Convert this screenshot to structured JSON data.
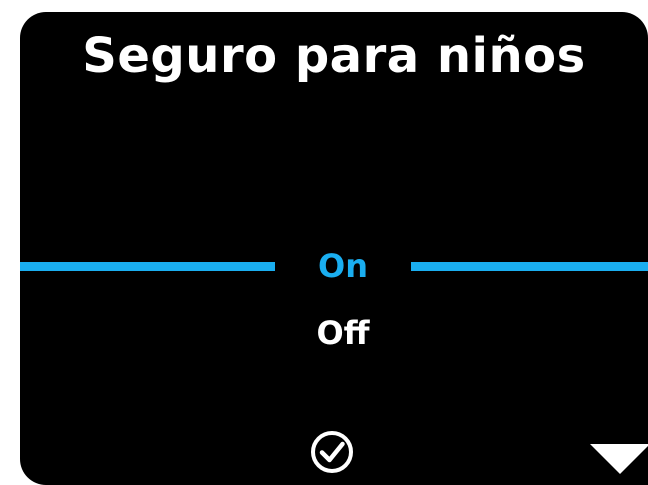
{
  "screen": {
    "title": "Seguro para niños"
  },
  "options": {
    "items": [
      {
        "label": "On",
        "selected": true
      },
      {
        "label": "Off",
        "selected": false
      }
    ]
  },
  "controls": {
    "confirm_icon": "checkmark-circle-icon",
    "scroll_icon": "triangle-down-icon"
  },
  "colors": {
    "background": "#000000",
    "text": "#ffffff",
    "accent": "#1aaef0"
  }
}
